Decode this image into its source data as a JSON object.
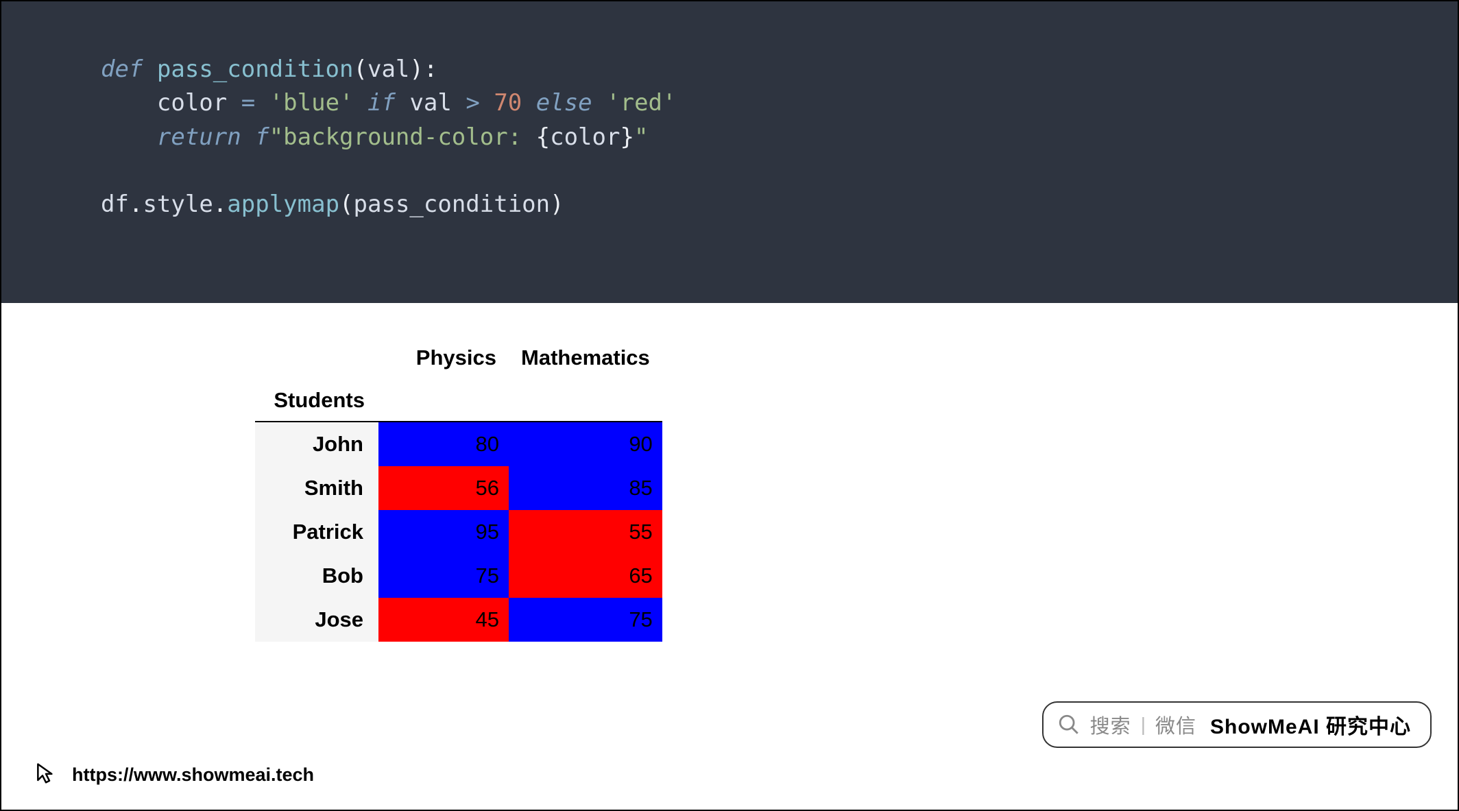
{
  "code": {
    "kw_def": "def",
    "fn_name": "pass_condition",
    "param": "val",
    "assign_target": "color",
    "str_blue": "'blue'",
    "kw_if": "if",
    "cond_lhs": "val",
    "op_gt": ">",
    "threshold": "70",
    "kw_else": "else",
    "str_red": "'red'",
    "kw_return": "return",
    "f_prefix": "f",
    "fstr_open": "\"background-color: ",
    "fstr_lbrace": "{",
    "fstr_var": "color",
    "fstr_rbrace": "}",
    "fstr_close": "\"",
    "expr_df": "df",
    "expr_style": "style",
    "expr_method": "applymap",
    "expr_arg": "pass_condition"
  },
  "table": {
    "columns": [
      "Physics",
      "Mathematics"
    ],
    "index_name": "Students",
    "rows": [
      {
        "name": "John",
        "values": [
          80,
          90
        ]
      },
      {
        "name": "Smith",
        "values": [
          56,
          85
        ]
      },
      {
        "name": "Patrick",
        "values": [
          95,
          55
        ]
      },
      {
        "name": "Bob",
        "values": [
          75,
          65
        ]
      },
      {
        "name": "Jose",
        "values": [
          45,
          75
        ]
      }
    ],
    "rule": {
      "threshold": 70,
      "gt_color": "blue",
      "le_color": "red"
    }
  },
  "footer": {
    "url": "https://www.showmeai.tech"
  },
  "badge": {
    "search_label": "搜索",
    "wechat_label": "微信",
    "brand": "ShowMeAI 研究中心"
  }
}
